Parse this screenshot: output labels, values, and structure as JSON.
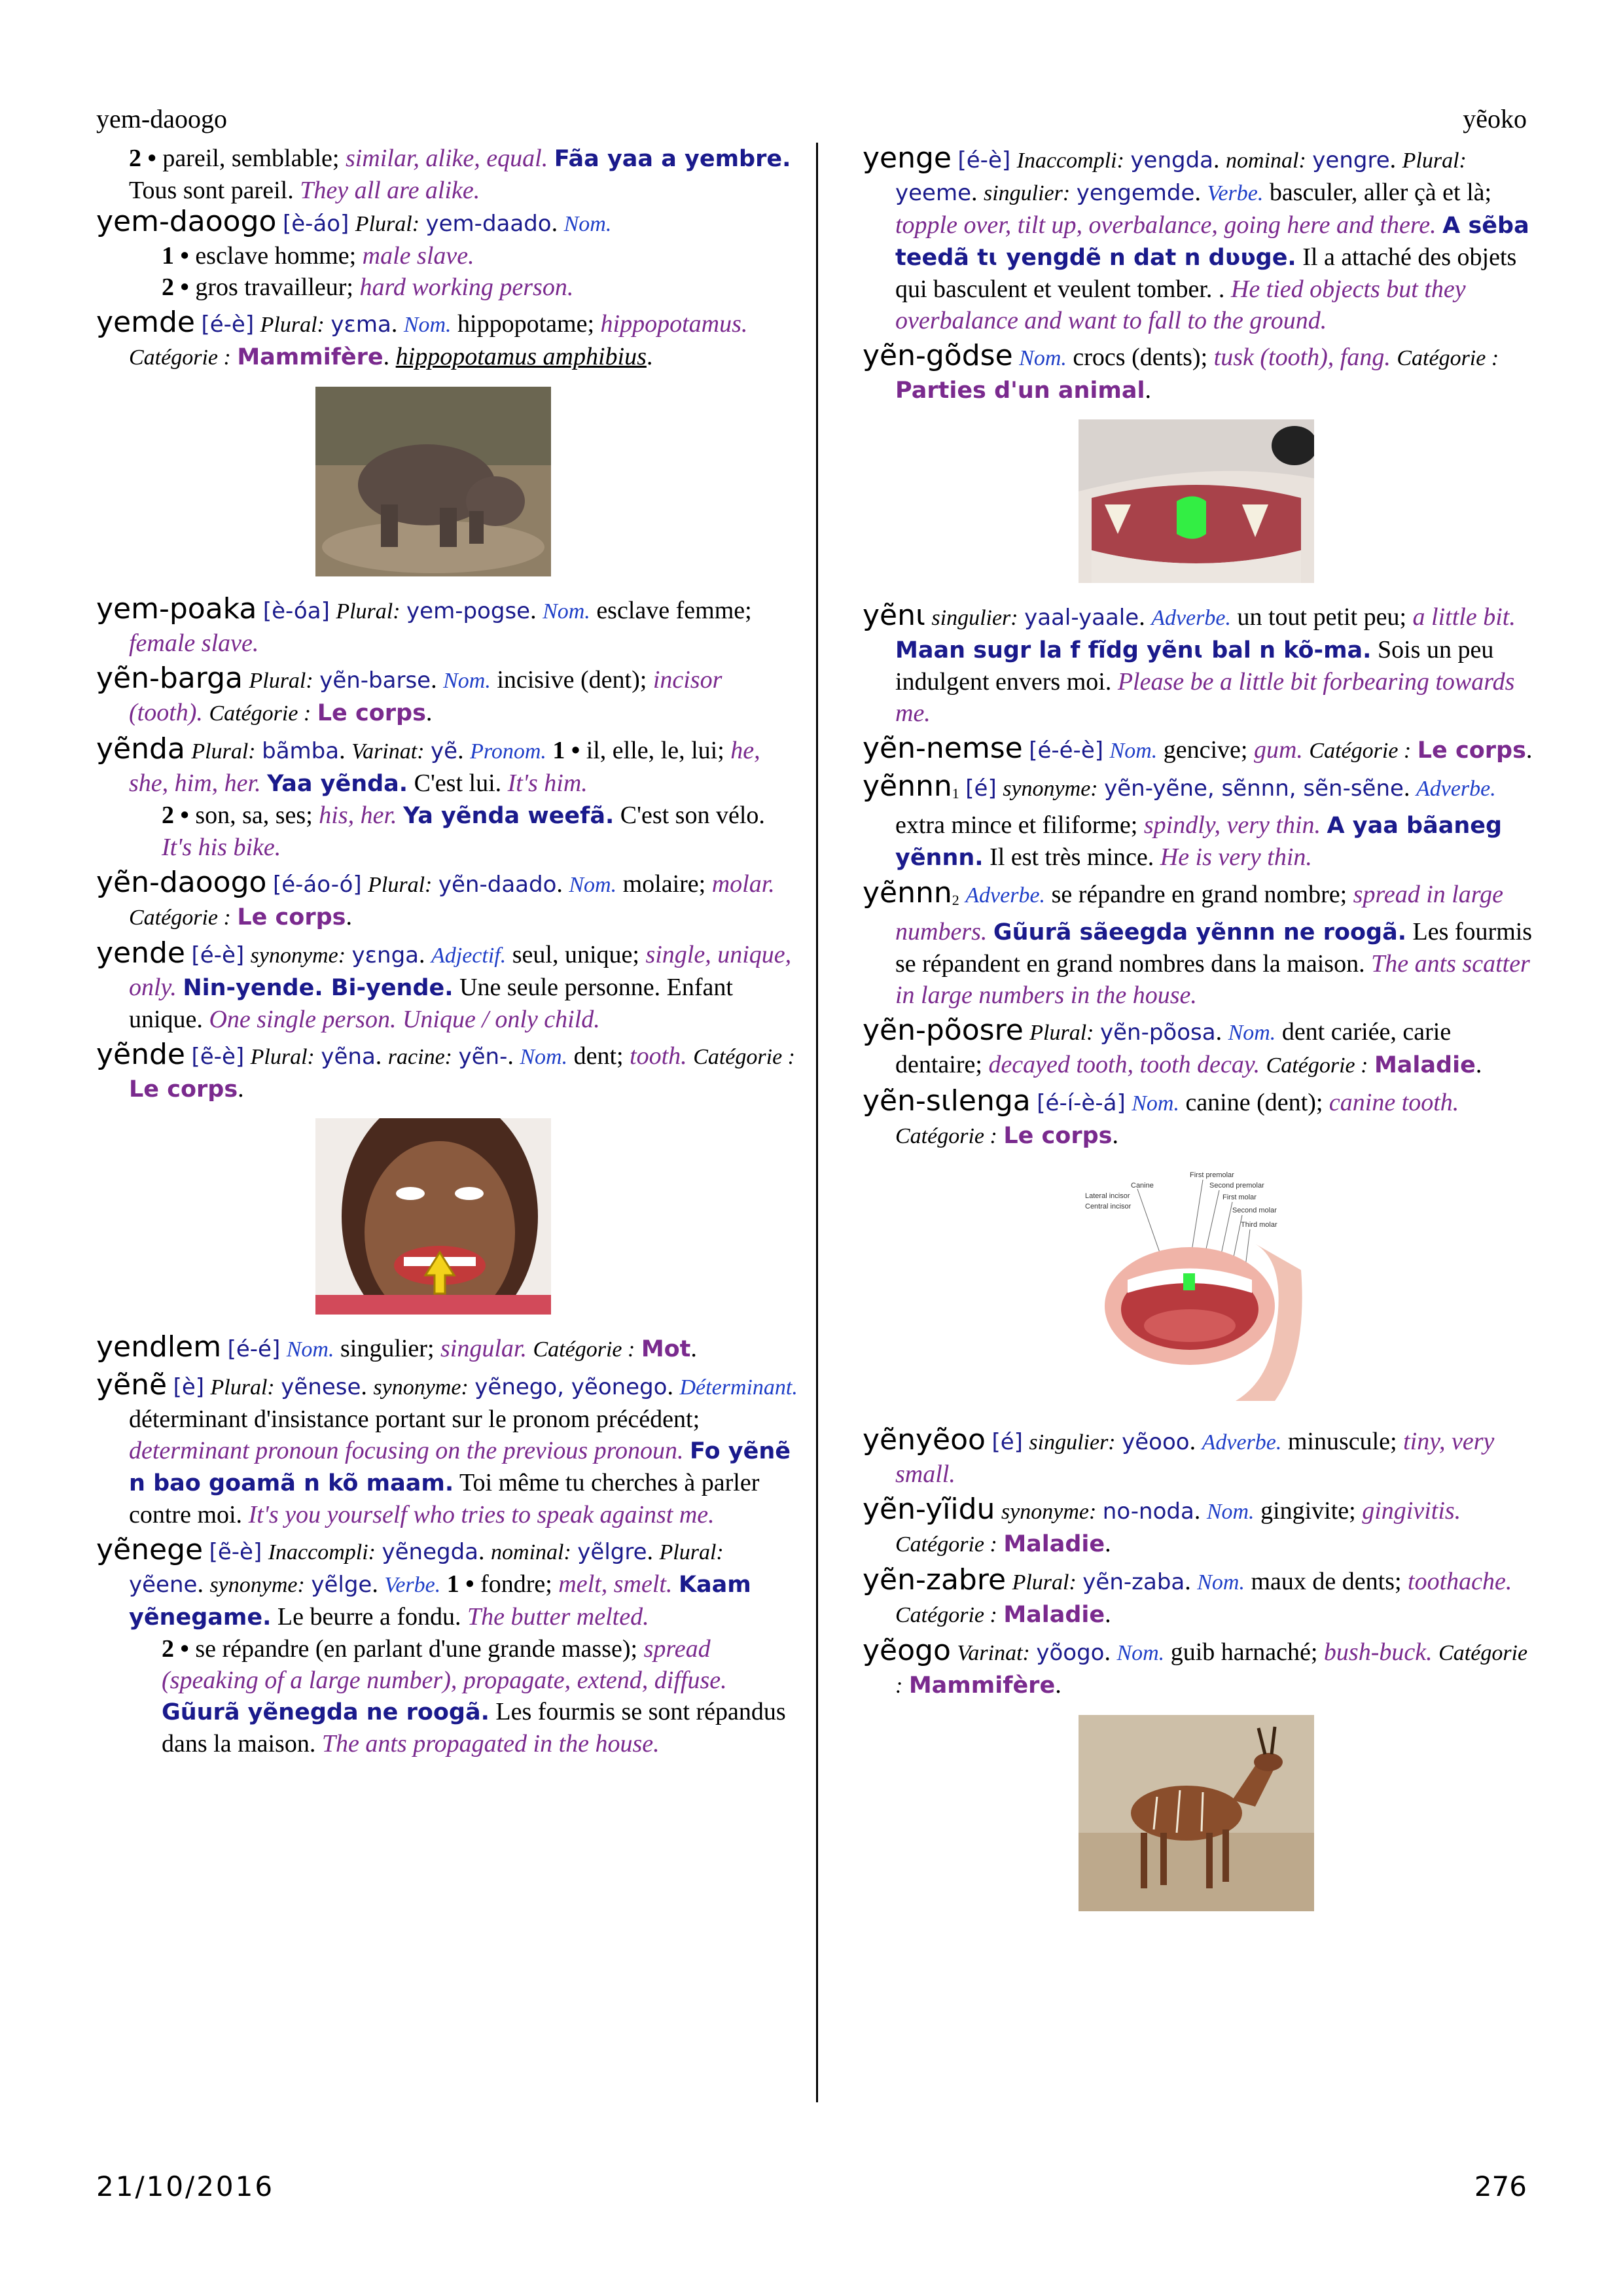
{
  "header": {
    "left": "yem-daoogo",
    "right": "yẽoko"
  },
  "footer": {
    "date": "21/10/2016",
    "page_number": "276"
  },
  "labels": {
    "plural": "Plural:",
    "nom": "Nom.",
    "categorie": "Catégorie :",
    "varinat": "Varinat:",
    "pronom": "Pronom.",
    "synonyme": "synonyme:",
    "adjectif": "Adjectif.",
    "racine": "racine:",
    "determinant": "Déterminant.",
    "inaccompli": "Inaccompli:",
    "nominal": "nominal:",
    "verbe": "Verbe.",
    "singulier": "singulier:",
    "adverbe": "Adverbe.",
    "one": "1 •",
    "two": "2 •"
  },
  "left": {
    "e1": {
      "fr1": "pareil, semblable;",
      "en1": "similar, alike, equal.",
      "ex": "Fãa yaa a yembre.",
      "fr2": "Tous sont pareil.",
      "en2": "They all are alike."
    },
    "e2": {
      "hw": "yem-daoogo",
      "pron": "[è-áo]",
      "pl": "yem-daado",
      "s1fr": "esclave homme;",
      "s1en": "male slave.",
      "s2fr": "gros travailleur;",
      "s2en": "hard working person."
    },
    "e3": {
      "hw": "yemde",
      "pron": "[é-è]",
      "pl": "yɛma",
      "fr": "hippopotame;",
      "en": "hippopotamus.",
      "cat": "Mammifère",
      "sci": "hippopotamus amphibius"
    },
    "e4": {
      "hw": "yem-poaka",
      "pron": "[è-óa]",
      "pl": "yem-pogse",
      "fr": "esclave femme;",
      "en": "female slave."
    },
    "e5": {
      "hw": "yẽn-barga",
      "pl": "yẽn-barse",
      "fr": "incisive (dent);",
      "en": "incisor (tooth).",
      "cat": "Le corps"
    },
    "e6": {
      "hw": "yẽnda",
      "pl": "bãmba",
      "var": "yẽ",
      "s1fr": "il, elle, le, lui;",
      "s1en": "he, she, him, her.",
      "s1ex": "Yaa yẽnda.",
      "s1exfr": "C'est lui.",
      "s1exen": "It's him.",
      "s2fr": "son, sa, ses;",
      "s2en": "his, her.",
      "s2ex": "Ya yẽnda weefã.",
      "s2exfr": "C'est son vélo.",
      "s2exen": "It's his bike."
    },
    "e7": {
      "hw": "yẽn-daoogo",
      "pron": "[é-áo-ó]",
      "pl": "yẽn-daado",
      "fr": "molaire;",
      "en": "molar.",
      "cat": "Le corps"
    },
    "e8": {
      "hw": "yende",
      "pron": "[é-è]",
      "syn": "yɛnga",
      "fr": "seul, unique;",
      "en": "single, unique, only.",
      "ex": "Nin-yende. Bi-yende.",
      "exfr": "Une seule personne. Enfant unique.",
      "exen": "One single person. Unique / only child."
    },
    "e9": {
      "hw": "yẽnde",
      "pron": "[ẽ-è]",
      "pl": "yẽna",
      "rac": "yẽn-",
      "fr": "dent;",
      "en": "tooth.",
      "cat": "Le corps"
    },
    "e10": {
      "hw": "yendlem",
      "pron": "[é-é]",
      "fr": "singulier;",
      "en": "singular.",
      "cat": "Mot"
    },
    "e11": {
      "hw": "yẽnẽ",
      "pron": "[è]",
      "pl": "yẽnese",
      "syn": "yẽnego, yẽonego",
      "fr": "déterminant d'insistance portant sur le pronom précédent;",
      "en": "determinant pronoun focusing on the previous pronoun.",
      "ex": "Fo yẽnẽ n bao goamã n kõ maam.",
      "exfr": "Toi même tu cherches à parler contre moi.",
      "exen": "It's you yourself who tries to speak against me."
    },
    "e12": {
      "hw": "yẽnege",
      "pron": "[ẽ-è]",
      "inacc": "yẽnegda",
      "nomi": "yẽlgre",
      "pl": "yẽene",
      "syn": "yẽlge",
      "s1fr": "fondre;",
      "s1en": "melt, smelt.",
      "s1ex": "Kaam yẽnegame.",
      "s1exfr": "Le beurre a fondu.",
      "s1exen": "The butter melted.",
      "s2fr": "se répandre (en parlant d'une grande masse);",
      "s2en": "spread (speaking of a large number), propagate, extend, diffuse.",
      "s2ex": "Gũurã yẽnegda ne roogã.",
      "s2exfr": "Les fourmis se sont répandus dans la maison.",
      "s2exen": "The ants propagated in the house."
    }
  },
  "right": {
    "r1": {
      "hw": "yenge",
      "pron": "[é-è]",
      "inacc": "yengda",
      "nomi": "yengre",
      "pl": "yeeme",
      "sing": "yengemde",
      "fr": "basculer, aller çà et là;",
      "en": "topple over, tilt up, overbalance, going here and there.",
      "ex": "A sẽba teedã tɩ yengdẽ n dat n dʋʋge.",
      "exfr": "Il a attaché des objets qui basculent et veulent tomber. .",
      "exen": "He tied objects but they overbalance and want to fall to the ground."
    },
    "r2": {
      "hw": "yẽn-gõdse",
      "fr": "crocs (dents);",
      "en": "tusk (tooth), fang.",
      "cat": "Parties d'un animal"
    },
    "r3": {
      "hw": "yẽnɩ",
      "sing": "yaal-yaale",
      "fr": "un tout petit peu;",
      "en": "a little bit.",
      "ex": "Maan sugr la f fĩdg yẽnɩ bal n kõ-ma.",
      "exfr": "Sois un peu indulgent envers moi.",
      "exen": "Please be a little bit forbearing towards me."
    },
    "r4": {
      "hw": "yẽn-nemse",
      "pron": "[é-é-è]",
      "fr": "gencive;",
      "en": "gum.",
      "cat": "Le corps"
    },
    "r5": {
      "hw": "yẽnnn",
      "num": "1",
      "pron": "[é]",
      "syn": "yẽn-yẽne, sẽnnn, sẽn-sẽne",
      "fr": "extra mince et filiforme;",
      "en": "spindly, very thin.",
      "ex": "A yaa bãaneg yẽnnn.",
      "exfr": "Il est très mince.",
      "exen": "He is very thin."
    },
    "r6": {
      "hw": "yẽnnn",
      "num": "2",
      "fr": "se répandre en grand nombre;",
      "en": "spread in large numbers.",
      "ex": "Gũurã sãeegda yẽnnn ne roogã.",
      "exfr": "Les fourmis se répandent en grand nombres dans la maison.",
      "exen": "The ants scatter in large numbers in the house."
    },
    "r7": {
      "hw": "yẽn-põosre",
      "pl": "yẽn-põosa",
      "fr": "dent cariée, carie dentaire;",
      "en": "decayed tooth, tooth decay.",
      "cat": "Maladie"
    },
    "r8": {
      "hw": "yẽn-sɩlenga",
      "pron": "[é-í-è-á]",
      "fr": "canine (dent);",
      "en": "canine tooth.",
      "cat": "Le corps"
    },
    "r9": {
      "hw": "yẽnyẽoo",
      "pron": "[é]",
      "sing": "yẽooo",
      "fr": "minuscule;",
      "en": "tiny, very small."
    },
    "r10": {
      "hw": "yẽn-yĩidu",
      "syn": "no-noda",
      "fr": "gingivite;",
      "en": "gingivitis.",
      "cat": "Maladie"
    },
    "r11": {
      "hw": "yẽn-zabre",
      "pl": "yẽn-zaba",
      "fr": "maux de dents;",
      "en": "toothache.",
      "cat": "Maladie"
    },
    "r12": {
      "hw": "yẽogo",
      "var": "yõogo",
      "fr": "guib harnaché;",
      "en": "bush-buck.",
      "cat": "Mammifère"
    }
  },
  "images": {
    "hippo": "hippopotamus-photo",
    "smile": "woman-smile-tooth-arrow-photo",
    "fangs": "dog-fangs-photo",
    "canine": "canine-tooth-diagram",
    "buck": "bushbuck-photo",
    "diagram_labels": [
      "First premolar",
      "Second premolar",
      "Canine",
      "Lateral incisor",
      "Central incisor",
      "First molar",
      "Second molar",
      "Third molar"
    ],
    "highlight_color": "#33ee44"
  }
}
